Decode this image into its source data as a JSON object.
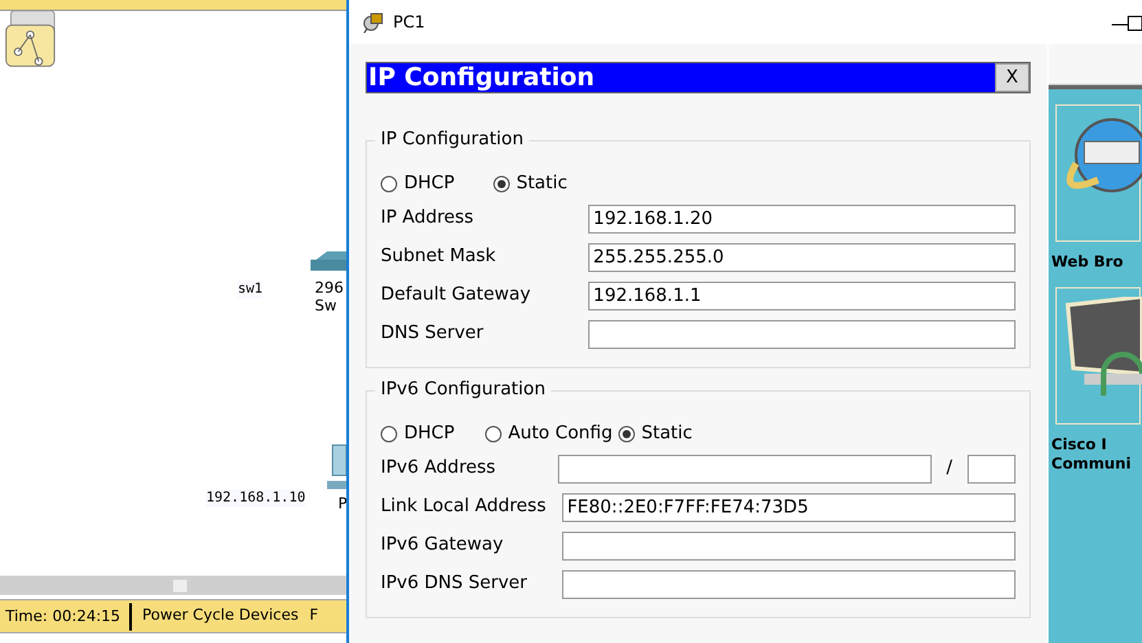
{
  "workspace": {
    "nodes": [
      {
        "kind": "label",
        "text": "sw1"
      },
      {
        "kind": "switch",
        "lines": [
          "296",
          "Sw"
        ]
      },
      {
        "kind": "label",
        "text": "192.168.1.10"
      },
      {
        "kind": "pc",
        "lines": [
          "P"
        ]
      }
    ]
  },
  "status_bar": {
    "time": "Time: 00:24:15",
    "items": [
      "Power Cycle Devices",
      "F"
    ]
  },
  "window": {
    "title": "PC1",
    "panel_title": "IP Configuration",
    "close_label": "X",
    "ipv4": {
      "legend": "IP Configuration",
      "modes": [
        {
          "label": "DHCP",
          "selected": false
        },
        {
          "label": "Static",
          "selected": true
        }
      ],
      "fields": [
        {
          "label": "IP Address",
          "value": "192.168.1.20"
        },
        {
          "label": "Subnet Mask",
          "value": "255.255.255.0"
        },
        {
          "label": "Default Gateway",
          "value": "192.168.1.1"
        },
        {
          "label": "DNS Server"
        }
      ]
    },
    "ipv6": {
      "legend": "IPv6 Configuration",
      "modes": [
        {
          "label": "DHCP",
          "selected": false
        },
        {
          "label": "Auto Config",
          "selected": false
        },
        {
          "label": "Static",
          "selected": true
        }
      ],
      "fields": [
        {
          "kind": "prefix",
          "label": "IPv6 Address",
          "separator": "/"
        },
        {
          "kind": "plain",
          "label": "Link Local Address",
          "value": "FE80::2E0:F7FF:FE74:73D5"
        },
        {
          "kind": "plain",
          "label": "IPv6 Gateway"
        },
        {
          "kind": "plain",
          "label": "IPv6 DNS Server"
        }
      ]
    }
  },
  "desktop_apps": [
    {
      "kind": "browser",
      "lines": [
        "Web Bro"
      ]
    },
    {
      "kind": "phone",
      "lines": [
        "Cisco I",
        "Communi"
      ]
    }
  ]
}
